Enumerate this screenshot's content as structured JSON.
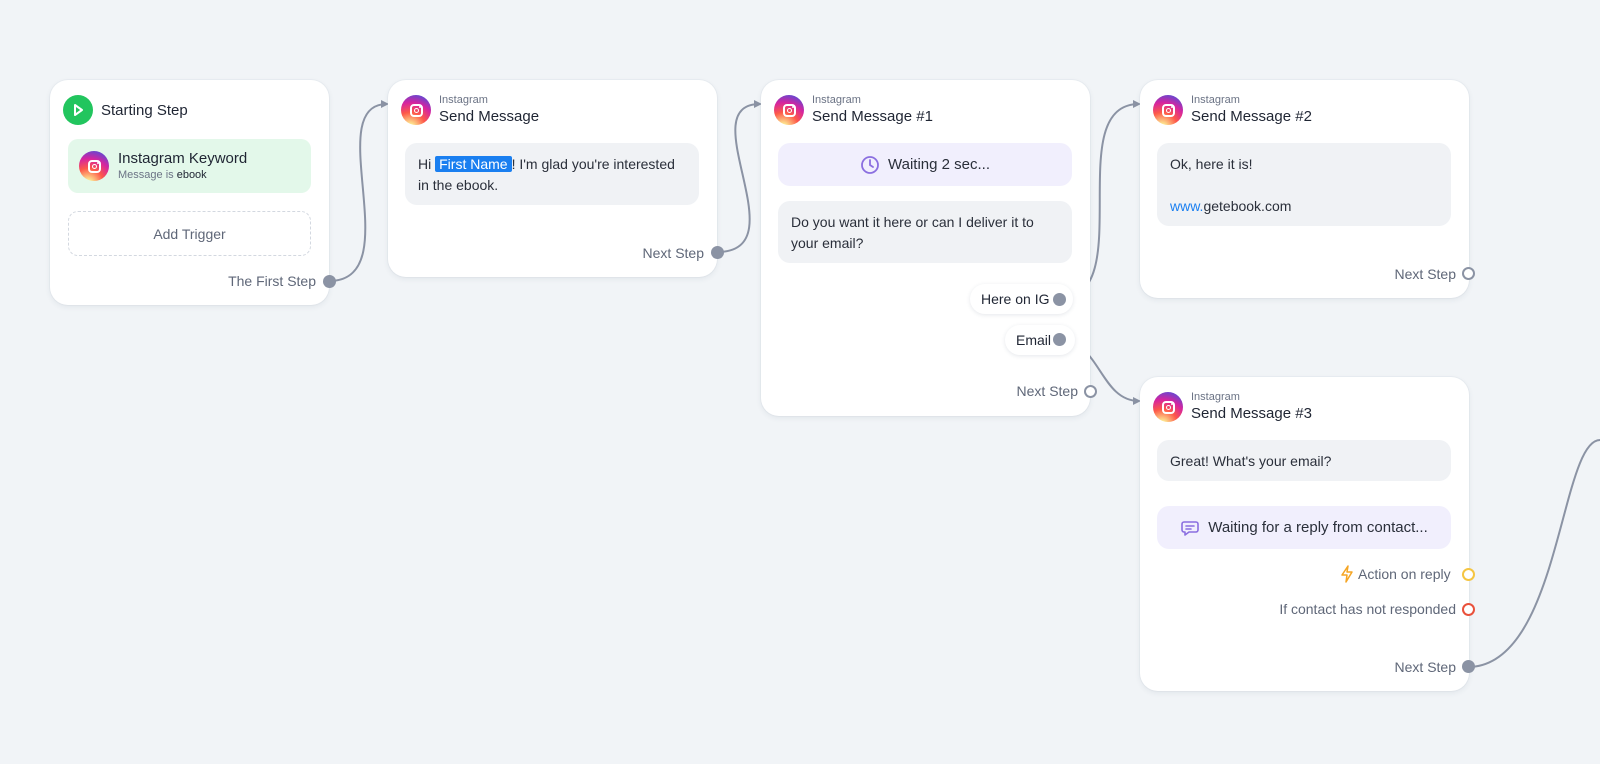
{
  "start": {
    "title": "Starting Step",
    "trigger": {
      "title": "Instagram Keyword",
      "desc_prefix": "Message is",
      "desc_value": "ebook"
    },
    "add_trigger": "Add Trigger",
    "port_label": "The First Step"
  },
  "send1": {
    "platform": "Instagram",
    "title": "Send Message",
    "message_pre": "Hi",
    "message_tag": "First Name",
    "message_post": "! I'm glad you're interested in the ebook.",
    "port_label": "Next Step"
  },
  "send2": {
    "platform": "Instagram",
    "title": "Send Message #1",
    "wait_text": "Waiting 2 sec...",
    "message": "Do you want it here or can I deliver it to your email?",
    "buttons": [
      "Here on IG",
      "Email"
    ],
    "port_label": "Next Step"
  },
  "send3": {
    "platform": "Instagram",
    "title": "Send Message #2",
    "message_line1": "Ok, here it is!",
    "link_prefix": "www.",
    "link_rest": "getebook.com",
    "port_label": "Next Step"
  },
  "send4": {
    "platform": "Instagram",
    "title": "Send Message #3",
    "message": "Great! What's your email?",
    "reply_wait": "Waiting for a reply from contact...",
    "action_on_reply": "Action on reply",
    "not_responded": "If contact has not responded",
    "port_label": "Next Step"
  },
  "colors": {
    "accent": "#1a7ff0",
    "start_green": "#22c55e",
    "trigger_bg": "#e3f8ea",
    "wait_bg": "#f1effd",
    "wire": "#8b93a4",
    "yellow": "#f5c542",
    "red": "#e9513b",
    "purple": "#8b6fe0"
  }
}
